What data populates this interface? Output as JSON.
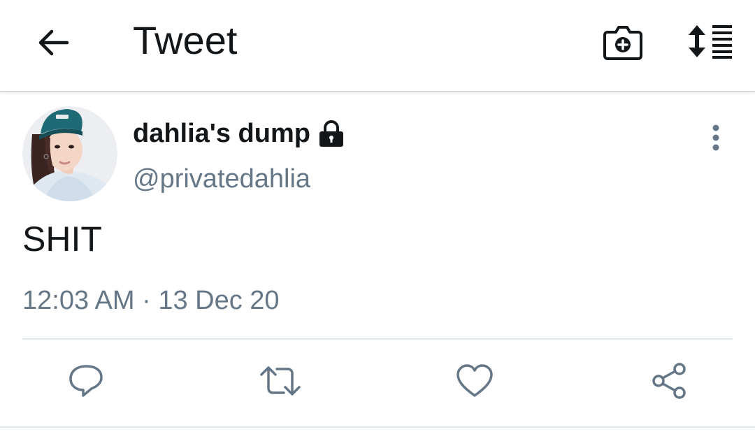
{
  "header": {
    "title": "Tweet",
    "back_icon": "arrow-left-icon",
    "camera_icon": "camera-plus-icon",
    "sort_icon": "sort-list-icon"
  },
  "tweet": {
    "display_name": "dahlia's dump",
    "protected_icon": "lock-icon",
    "handle": "@privatedahlia",
    "text": "SHIT",
    "timestamp": "12:03 AM · 13 Dec 20",
    "more_icon": "more-vertical-icon"
  },
  "actions": {
    "reply_icon": "reply-icon",
    "retweet_icon": "retweet-icon",
    "like_icon": "heart-icon",
    "share_icon": "share-icon"
  },
  "colors": {
    "primary_text": "#14171a",
    "secondary_text": "#657786",
    "divider": "#e1e8ed"
  }
}
